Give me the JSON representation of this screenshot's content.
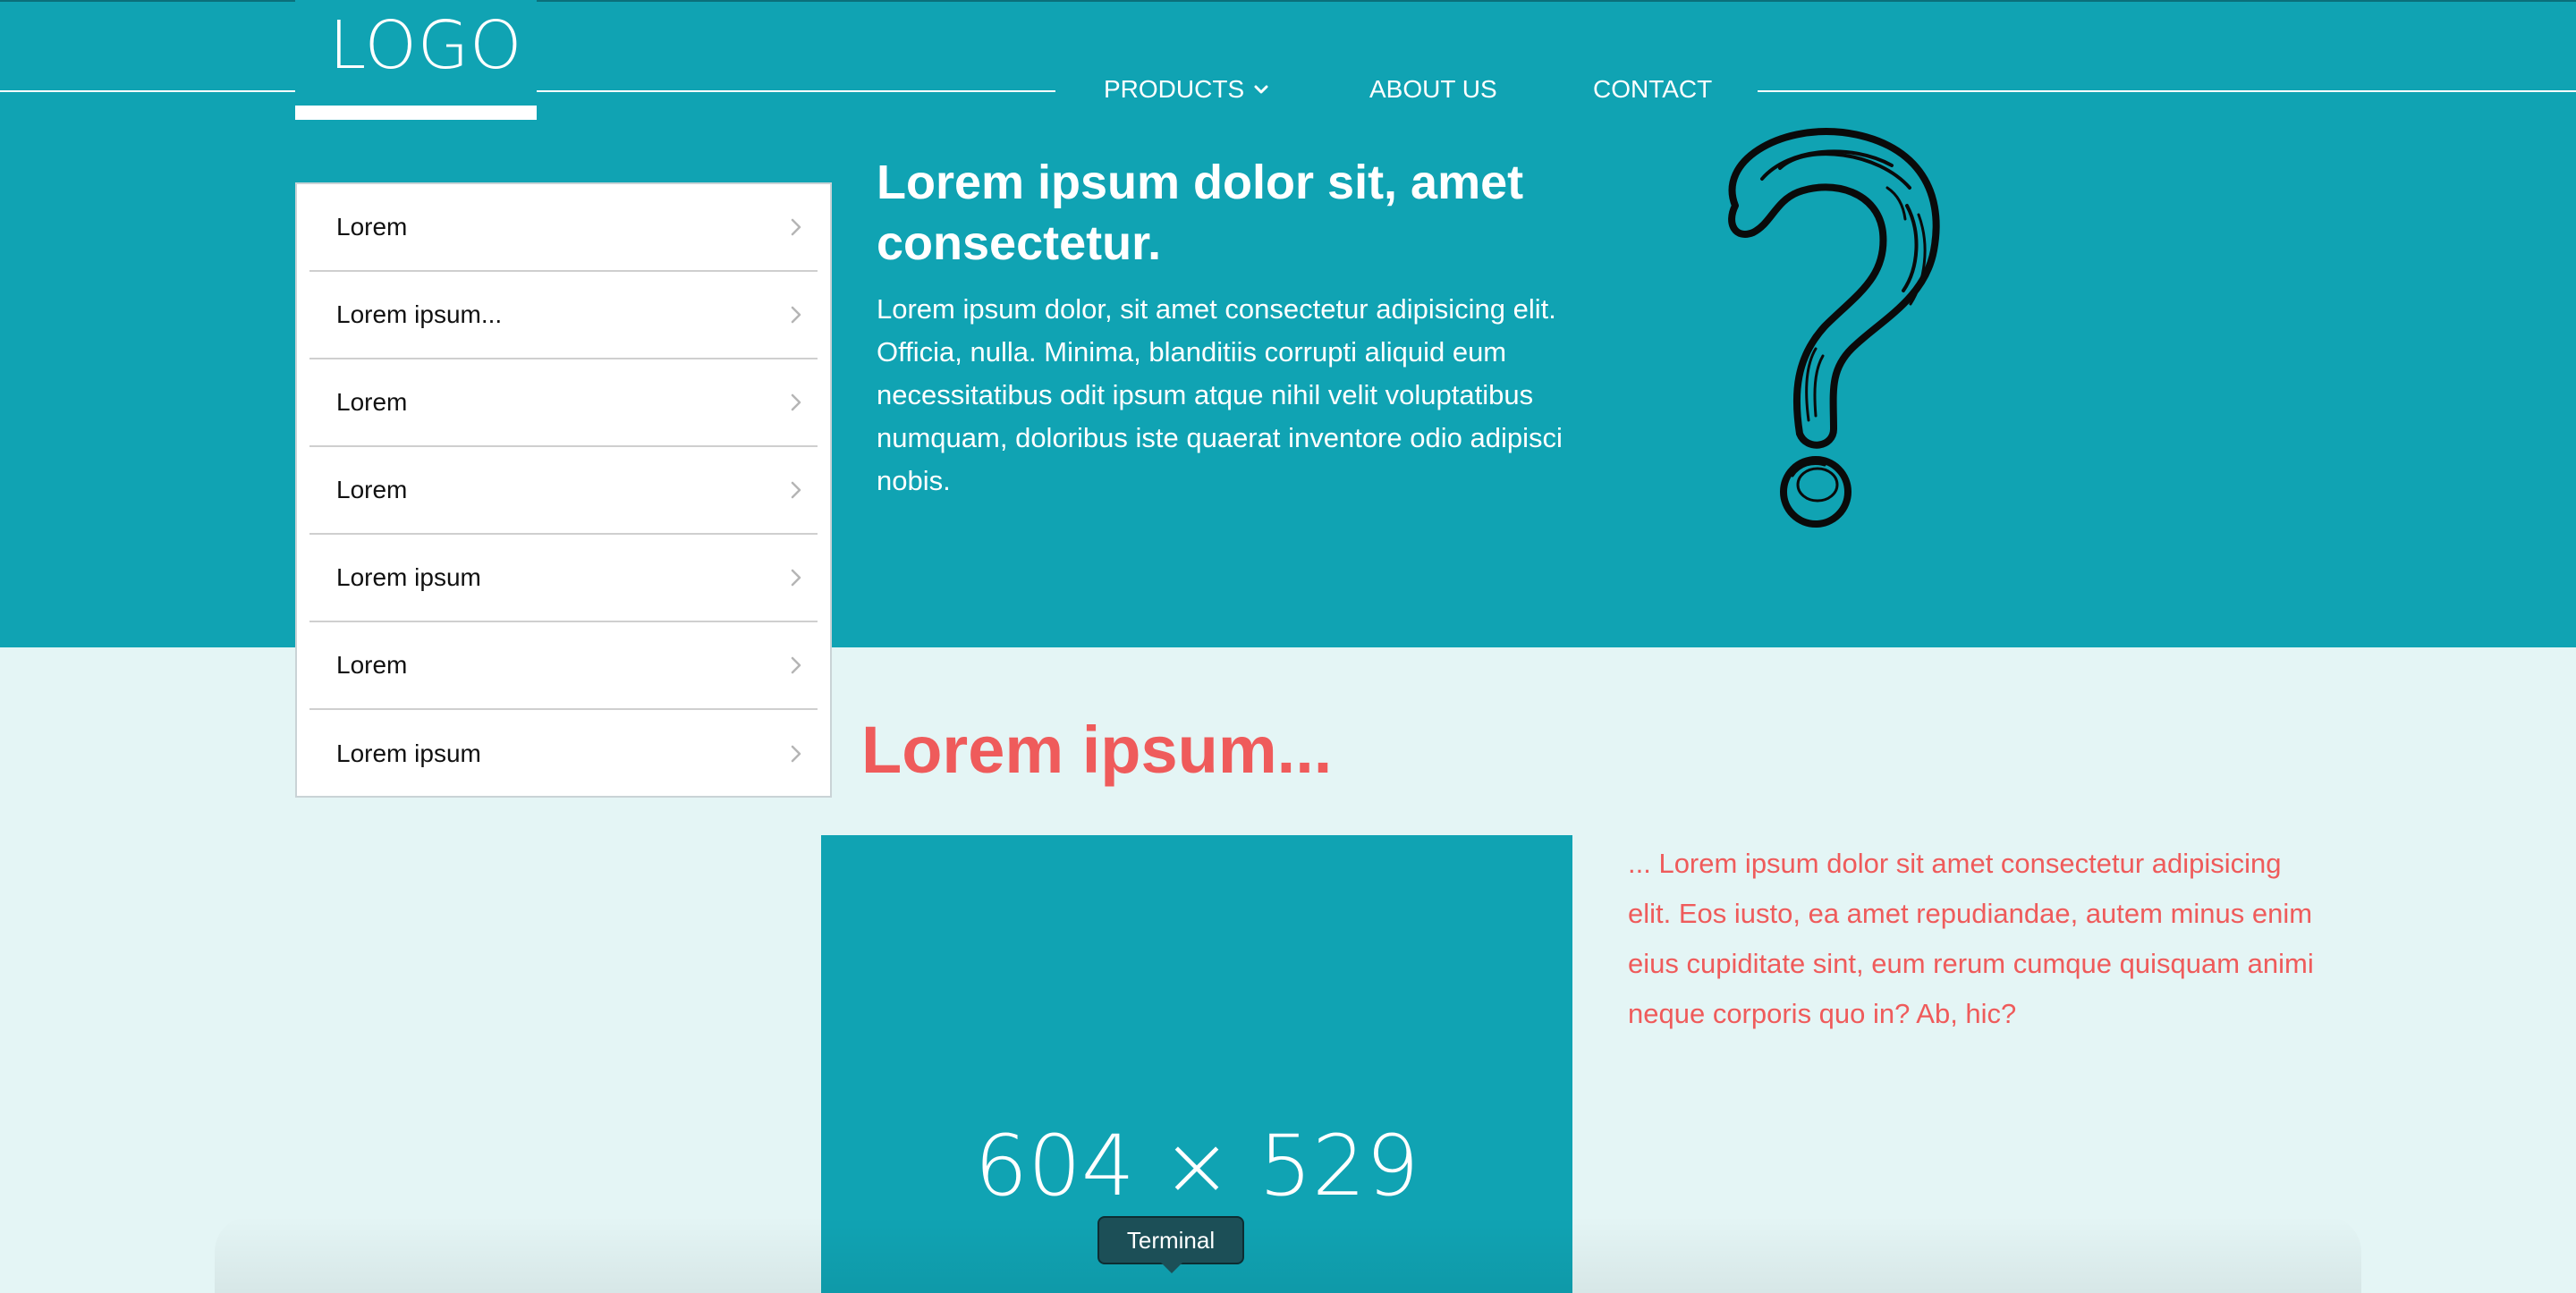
{
  "header": {
    "logo_text": "LOGO",
    "nav": [
      {
        "label": "PRODUCTS",
        "has_dropdown": true
      },
      {
        "label": "ABOUT US"
      },
      {
        "label": "CONTACT"
      }
    ]
  },
  "sidebar": {
    "items": [
      {
        "label": "Lorem"
      },
      {
        "label": "Lorem ipsum..."
      },
      {
        "label": "Lorem"
      },
      {
        "label": "Lorem"
      },
      {
        "label": "Lorem ipsum"
      },
      {
        "label": "Lorem"
      },
      {
        "label": "Lorem ipsum"
      }
    ]
  },
  "hero": {
    "title": "Lorem ipsum dolor sit, amet consectetur.",
    "text": "Lorem ipsum dolor, sit amet consectetur adipisicing elit. Officia, nulla. Minima, blanditiis corrupti aliquid eum necessitatibus odit ipsum atque nihil velit voluptatibus numquam, doloribus iste quaerat inventore odio adipisci nobis.",
    "image_icon": "question-mark-sketch-icon"
  },
  "section": {
    "title": "Lorem ipsum...",
    "placeholder_label": "604 × 529",
    "text": "... Lorem ipsum dolor sit amet consectetur adipisicing elit. Eos iusto, ea amet repudiandae, autem minus enim eius cupiditate sint, eum rerum cumque quisquam animi neque corporis quo in? Ab, hic?"
  },
  "tooltip": {
    "label": "Terminal"
  },
  "colors": {
    "hero_bg": "#10a3b3",
    "page_bg": "#e4f5f5",
    "accent_red": "#ef5b5b",
    "white": "#ffffff"
  }
}
